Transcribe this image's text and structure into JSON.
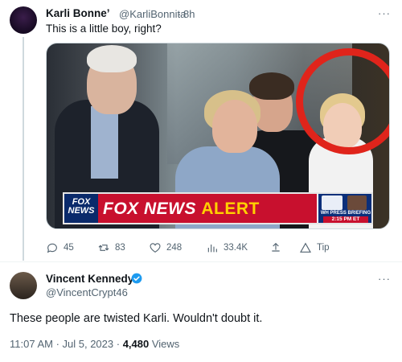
{
  "parent_tweet": {
    "author_name": "Karli Bonne’",
    "author_handle": "@KarliBonnita",
    "separator": "·",
    "time": "8h",
    "text": "This is a little boy, right?",
    "more_label": "···",
    "media": {
      "banner_text_white": "FOX NEWS",
      "banner_text_yellow": "ALERT",
      "logo_line1": "FOX",
      "logo_line2": "NEWS",
      "wh_line1": "WH PRESS BRIEFING",
      "wh_line2": "2:15 PM ET"
    },
    "actions": {
      "replies": "45",
      "retweets": "83",
      "likes": "248",
      "views": "33.4K",
      "tip_label": "Tip"
    }
  },
  "main_tweet": {
    "author_name": "Vincent Kennedy",
    "author_handle": "@VincentCrypt46",
    "more_label": "···",
    "text": "These people are twisted Karli. Wouldn't doubt it.",
    "time": "11:07 AM · Jul 5, 2023 ·",
    "views_count": "4,480",
    "views_label": "Views"
  },
  "colors": {
    "accent_blue": "#1d9bf0",
    "alert_red": "#c8102e",
    "alert_yellow": "#ffd100",
    "secondary_text": "#536471"
  }
}
